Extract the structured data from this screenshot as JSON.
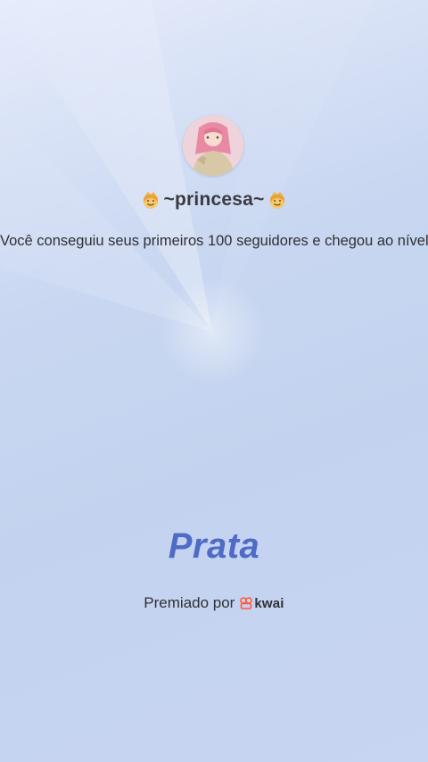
{
  "profile": {
    "username": "~princesa~",
    "avatar_icon": "profile-photo-icon",
    "decoration_icon": "crowned-face-emoji-icon"
  },
  "achievement": {
    "message": "Você conseguiu seus primeiros 100 seguidores e chegou ao nível"
  },
  "level": {
    "title": "Prata",
    "color": "#4f6bc6"
  },
  "awarded": {
    "label": "Premiado por",
    "brand_name": "kwai",
    "brand_color": "#ff5a3c",
    "brand_icon": "kwai-logo-icon"
  },
  "colors": {
    "background": "#c9d7f1",
    "text": "#2f3034"
  }
}
